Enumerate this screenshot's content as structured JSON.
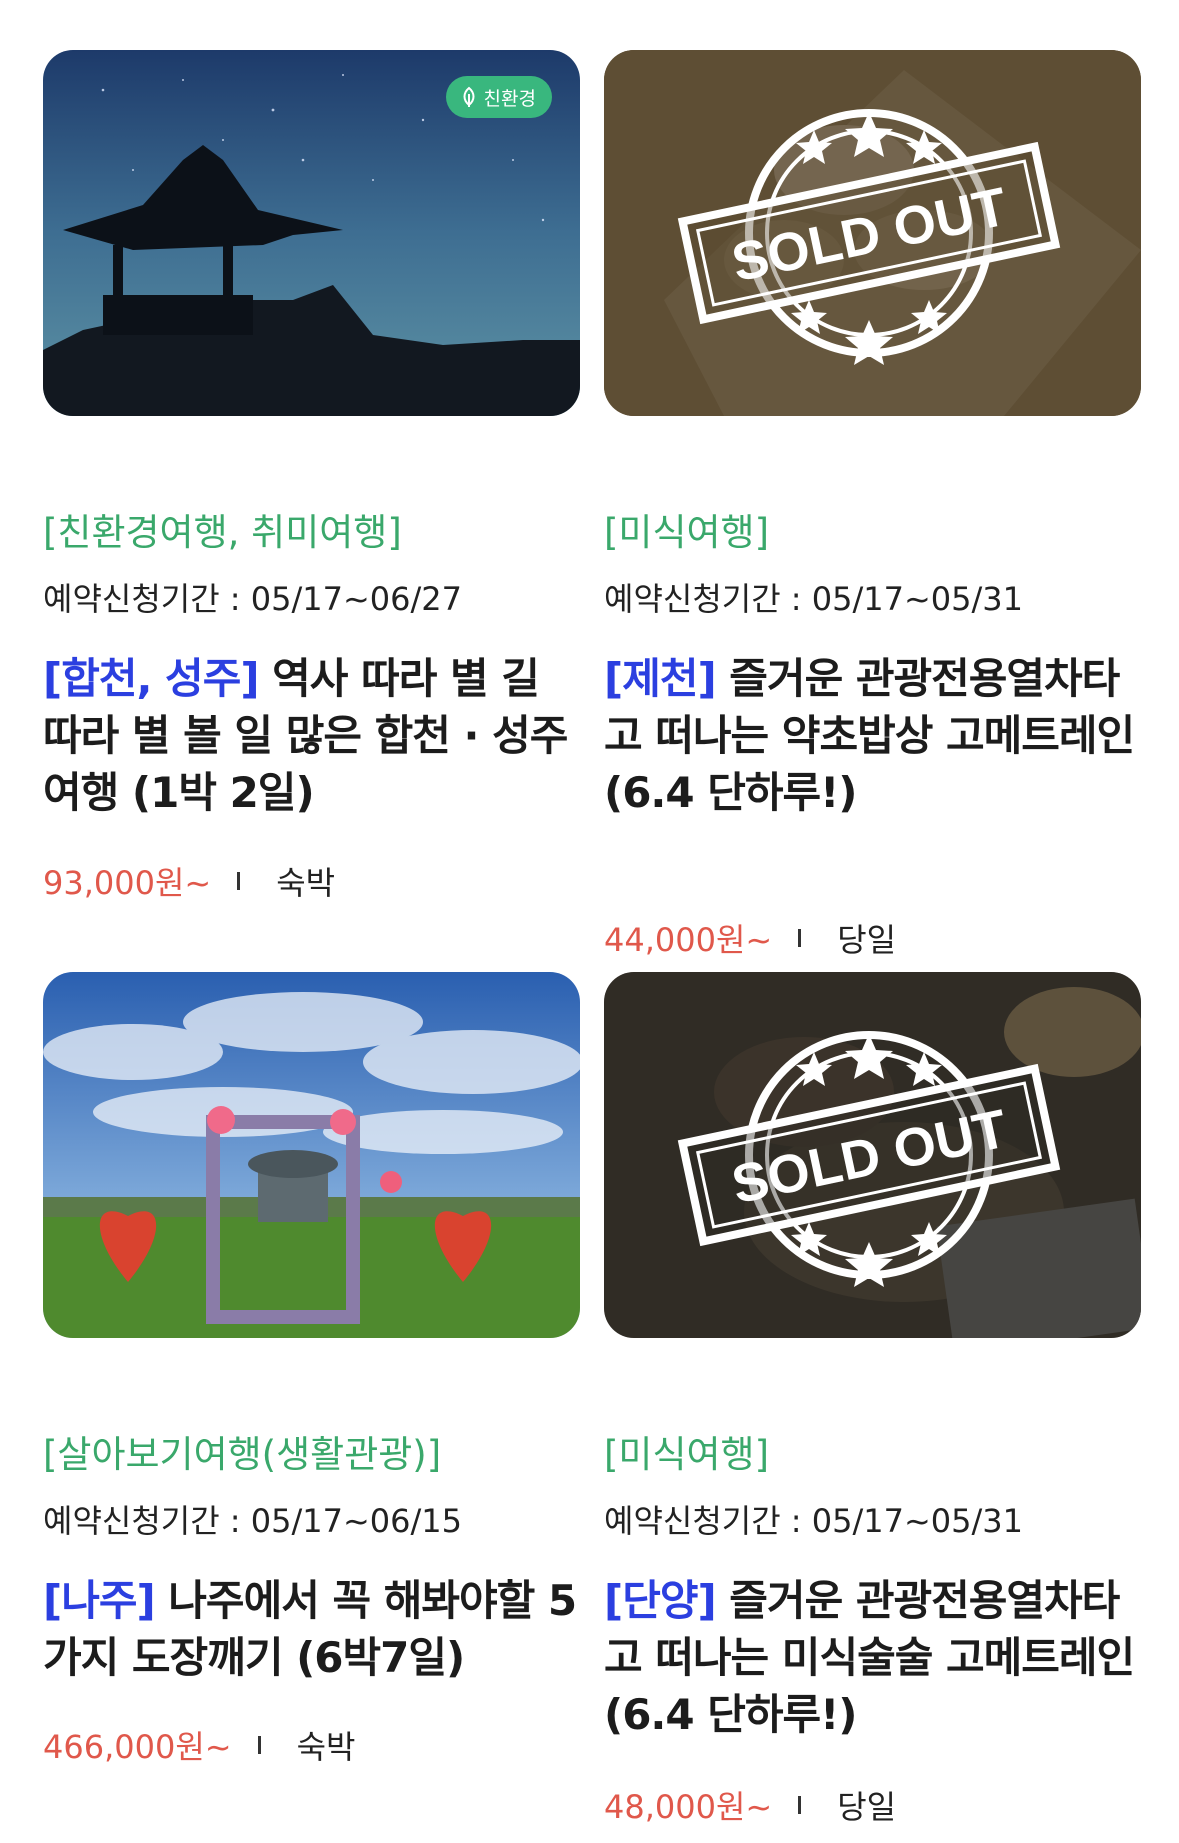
{
  "colors": {
    "category": "#3aa86b",
    "region": "#2b3fe0",
    "price": "#e0584b",
    "eco_badge": "#39b77e"
  },
  "products": [
    {
      "image": "night-sky-pavilion",
      "badge": "친환경",
      "sold_out": false,
      "category": "[친환경여행, 취미여행]",
      "period": "예약신청기간 : 05/17~06/27",
      "region": "[합천, 성주]",
      "title": " 역사 따라 별 길 따라 별 볼 일 많은 합천 · 성주 여행 (1박 2일)",
      "price": "93,000원~",
      "type": "숙박"
    },
    {
      "image": "rice-cake-box",
      "badge": "",
      "sold_out": true,
      "sold_out_text": "SOLD OUT",
      "category": "[미식여행]",
      "period": "예약신청기간 : 05/17~05/31",
      "region": "[제천]",
      "title": " 즐거운 관광전용열차타고 떠나는 약초밥상 고메트레인(6.4 단하루!)",
      "price": "44,000원~",
      "type": "당일"
    },
    {
      "image": "heart-photo-frame",
      "badge": "",
      "sold_out": false,
      "category": "[살아보기여행(생활관광)]",
      "period": "예약신청기간 : 05/17~06/15",
      "region": "[나주]",
      "title": " 나주에서 꼭 해봐야할 5가지 도장깨기 (6박7일)",
      "price": "466,000원~",
      "type": "숙박"
    },
    {
      "image": "cooking-table",
      "badge": "",
      "sold_out": true,
      "sold_out_text": "SOLD OUT",
      "category": "[미식여행]",
      "period": "예약신청기간 : 05/17~05/31",
      "region": "[단양]",
      "title": " 즐거운 관광전용열차타고 떠나는 미식술술 고메트레인(6.4 단하루!)",
      "price": "48,000원~",
      "type": "당일"
    }
  ]
}
